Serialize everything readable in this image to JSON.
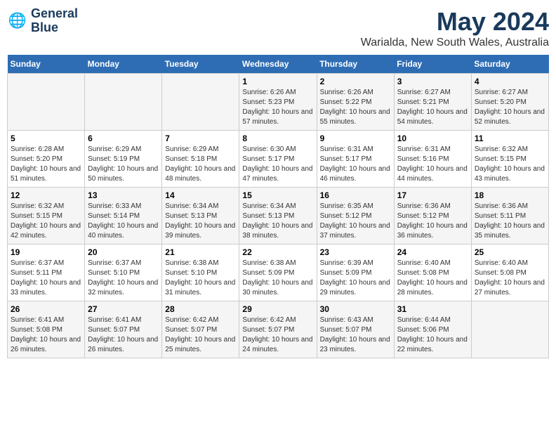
{
  "header": {
    "logo_line1": "General",
    "logo_line2": "Blue",
    "month": "May 2024",
    "location": "Warialda, New South Wales, Australia"
  },
  "weekdays": [
    "Sunday",
    "Monday",
    "Tuesday",
    "Wednesday",
    "Thursday",
    "Friday",
    "Saturday"
  ],
  "weeks": [
    [
      {
        "day": "",
        "info": ""
      },
      {
        "day": "",
        "info": ""
      },
      {
        "day": "",
        "info": ""
      },
      {
        "day": "1",
        "info": "Sunrise: 6:26 AM\nSunset: 5:23 PM\nDaylight: 10 hours and 57 minutes."
      },
      {
        "day": "2",
        "info": "Sunrise: 6:26 AM\nSunset: 5:22 PM\nDaylight: 10 hours and 55 minutes."
      },
      {
        "day": "3",
        "info": "Sunrise: 6:27 AM\nSunset: 5:21 PM\nDaylight: 10 hours and 54 minutes."
      },
      {
        "day": "4",
        "info": "Sunrise: 6:27 AM\nSunset: 5:20 PM\nDaylight: 10 hours and 52 minutes."
      }
    ],
    [
      {
        "day": "5",
        "info": "Sunrise: 6:28 AM\nSunset: 5:20 PM\nDaylight: 10 hours and 51 minutes."
      },
      {
        "day": "6",
        "info": "Sunrise: 6:29 AM\nSunset: 5:19 PM\nDaylight: 10 hours and 50 minutes."
      },
      {
        "day": "7",
        "info": "Sunrise: 6:29 AM\nSunset: 5:18 PM\nDaylight: 10 hours and 48 minutes."
      },
      {
        "day": "8",
        "info": "Sunrise: 6:30 AM\nSunset: 5:17 PM\nDaylight: 10 hours and 47 minutes."
      },
      {
        "day": "9",
        "info": "Sunrise: 6:31 AM\nSunset: 5:17 PM\nDaylight: 10 hours and 46 minutes."
      },
      {
        "day": "10",
        "info": "Sunrise: 6:31 AM\nSunset: 5:16 PM\nDaylight: 10 hours and 44 minutes."
      },
      {
        "day": "11",
        "info": "Sunrise: 6:32 AM\nSunset: 5:15 PM\nDaylight: 10 hours and 43 minutes."
      }
    ],
    [
      {
        "day": "12",
        "info": "Sunrise: 6:32 AM\nSunset: 5:15 PM\nDaylight: 10 hours and 42 minutes."
      },
      {
        "day": "13",
        "info": "Sunrise: 6:33 AM\nSunset: 5:14 PM\nDaylight: 10 hours and 40 minutes."
      },
      {
        "day": "14",
        "info": "Sunrise: 6:34 AM\nSunset: 5:13 PM\nDaylight: 10 hours and 39 minutes."
      },
      {
        "day": "15",
        "info": "Sunrise: 6:34 AM\nSunset: 5:13 PM\nDaylight: 10 hours and 38 minutes."
      },
      {
        "day": "16",
        "info": "Sunrise: 6:35 AM\nSunset: 5:12 PM\nDaylight: 10 hours and 37 minutes."
      },
      {
        "day": "17",
        "info": "Sunrise: 6:36 AM\nSunset: 5:12 PM\nDaylight: 10 hours and 36 minutes."
      },
      {
        "day": "18",
        "info": "Sunrise: 6:36 AM\nSunset: 5:11 PM\nDaylight: 10 hours and 35 minutes."
      }
    ],
    [
      {
        "day": "19",
        "info": "Sunrise: 6:37 AM\nSunset: 5:11 PM\nDaylight: 10 hours and 33 minutes."
      },
      {
        "day": "20",
        "info": "Sunrise: 6:37 AM\nSunset: 5:10 PM\nDaylight: 10 hours and 32 minutes."
      },
      {
        "day": "21",
        "info": "Sunrise: 6:38 AM\nSunset: 5:10 PM\nDaylight: 10 hours and 31 minutes."
      },
      {
        "day": "22",
        "info": "Sunrise: 6:38 AM\nSunset: 5:09 PM\nDaylight: 10 hours and 30 minutes."
      },
      {
        "day": "23",
        "info": "Sunrise: 6:39 AM\nSunset: 5:09 PM\nDaylight: 10 hours and 29 minutes."
      },
      {
        "day": "24",
        "info": "Sunrise: 6:40 AM\nSunset: 5:08 PM\nDaylight: 10 hours and 28 minutes."
      },
      {
        "day": "25",
        "info": "Sunrise: 6:40 AM\nSunset: 5:08 PM\nDaylight: 10 hours and 27 minutes."
      }
    ],
    [
      {
        "day": "26",
        "info": "Sunrise: 6:41 AM\nSunset: 5:08 PM\nDaylight: 10 hours and 26 minutes."
      },
      {
        "day": "27",
        "info": "Sunrise: 6:41 AM\nSunset: 5:07 PM\nDaylight: 10 hours and 26 minutes."
      },
      {
        "day": "28",
        "info": "Sunrise: 6:42 AM\nSunset: 5:07 PM\nDaylight: 10 hours and 25 minutes."
      },
      {
        "day": "29",
        "info": "Sunrise: 6:42 AM\nSunset: 5:07 PM\nDaylight: 10 hours and 24 minutes."
      },
      {
        "day": "30",
        "info": "Sunrise: 6:43 AM\nSunset: 5:07 PM\nDaylight: 10 hours and 23 minutes."
      },
      {
        "day": "31",
        "info": "Sunrise: 6:44 AM\nSunset: 5:06 PM\nDaylight: 10 hours and 22 minutes."
      },
      {
        "day": "",
        "info": ""
      }
    ]
  ]
}
